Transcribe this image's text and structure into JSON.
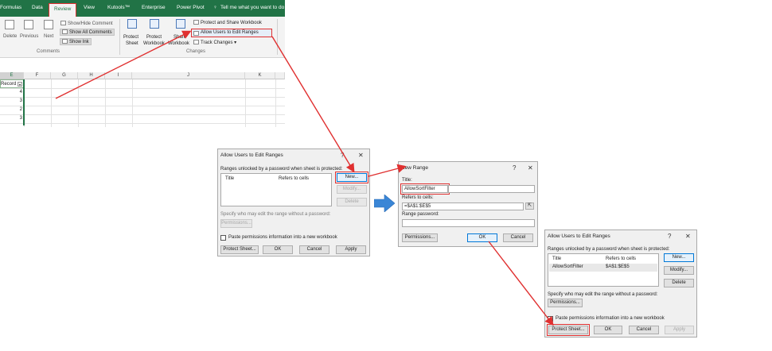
{
  "ribbon": {
    "tabs": [
      "Formulas",
      "Data",
      "Review",
      "View",
      "Kutools™",
      "Enterprise",
      "Power Pivot"
    ],
    "tell_me": "Tell me what you want to do",
    "comments": {
      "delete": "Delete",
      "previous": "Previous",
      "next": "Next",
      "show_hide": "Show/Hide Comment",
      "show_all": "Show All Comments",
      "show_ink": "Show Ink",
      "group_label": "Comments"
    },
    "changes": {
      "protect_sheet": [
        "Protect",
        "Sheet"
      ],
      "protect_workbook": [
        "Protect",
        "Workbook"
      ],
      "share_workbook": [
        "Share",
        "Workbook"
      ],
      "protect_share": "Protect and Share Workbook",
      "allow_users": "Allow Users to Edit Ranges",
      "track_changes": "Track Changes ▾",
      "group_label": "Changes"
    }
  },
  "sheet": {
    "columns": [
      "E",
      "F",
      "G",
      "H",
      "I",
      "J",
      "K"
    ],
    "header_cell": "Record",
    "values": [
      "4",
      "3",
      "2",
      "3"
    ]
  },
  "dialog1": {
    "title": "Allow Users to Edit Ranges",
    "help": "?",
    "close": "✕",
    "ranges_label": "Ranges unlocked by a password when sheet is protected:",
    "col_title": "Title",
    "col_refers": "Refers to cells",
    "new_btn": "New...",
    "modify_btn": "Modify...",
    "delete_btn": "Delete",
    "specify_label": "Specify who may edit the range without a password:",
    "permissions_btn": "Permissions...",
    "paste_label": "Paste permissions information into a new workbook",
    "protect_btn": "Protect Sheet...",
    "ok_btn": "OK",
    "cancel_btn": "Cancel",
    "apply_btn": "Apply"
  },
  "dialog2": {
    "title": "New Range",
    "help": "?",
    "close": "✕",
    "title_label": "Title:",
    "title_value": "AllowSortFilter",
    "refers_label": "Refers to cells:",
    "refers_value": "=$A$1:$E$5",
    "password_label": "Range password:",
    "password_value": "",
    "permissions_btn": "Permissions...",
    "ok_btn": "OK",
    "cancel_btn": "Cancel"
  },
  "dialog3": {
    "title": "Allow Users to Edit Ranges",
    "help": "?",
    "close": "✕",
    "ranges_label": "Ranges unlocked by a password when sheet is protected:",
    "col_title": "Title",
    "col_refers": "Refers to cells",
    "row_title": "AllowSortFilter",
    "row_refers": "$A$1:$E$5",
    "new_btn": "New...",
    "modify_btn": "Modify...",
    "delete_btn": "Delete",
    "specify_label": "Specify who may edit the range without a password:",
    "permissions_btn": "Permissions...",
    "paste_label": "Paste permissions information into a new workbook",
    "protect_btn": "Protect Sheet...",
    "ok_btn": "OK",
    "cancel_btn": "Cancel",
    "apply_btn": "Apply"
  },
  "colors": {
    "excel_green": "#217346",
    "annotation_red": "#e03030",
    "arrow_blue": "#3a86d6"
  }
}
